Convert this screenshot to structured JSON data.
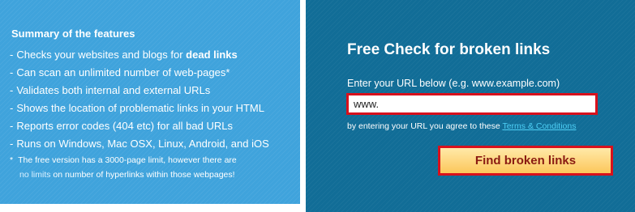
{
  "features": {
    "title": "Summary of the features",
    "items": [
      {
        "text": "Checks your websites and blogs for ",
        "bold": "dead links"
      },
      {
        "text": "Can scan an unlimited number of web-pages*",
        "bold": ""
      },
      {
        "text": "Validates both internal and external URLs",
        "bold": ""
      },
      {
        "text": "Shows the location of problematic links in your HTML",
        "bold": ""
      },
      {
        "text": "Reports error codes (404 etc) for all bad URLs",
        "bold": ""
      },
      {
        "text": "Runs on Windows, Mac OSX, Linux, Android, and iOS",
        "bold": ""
      }
    ],
    "bullet": "-",
    "footnote": {
      "star": "*",
      "line1": "The free version has a 3000-page limit, however there are",
      "link": "no limits",
      "line2_rest": " on number of hyperlinks within those webpages!"
    }
  },
  "check": {
    "title": "Free Check for broken links",
    "url_label": "Enter your URL below (e.g. www.example.com)",
    "url_value": "www.",
    "agree_text": "by entering your URL you agree to these ",
    "terms_link": "Terms & Conditions",
    "button_label": "Find broken links"
  },
  "colors": {
    "left_panel": "#3fa3dc",
    "right_panel": "#116d97",
    "highlight_border": "#d8111c",
    "button_text": "#8a1b12"
  }
}
